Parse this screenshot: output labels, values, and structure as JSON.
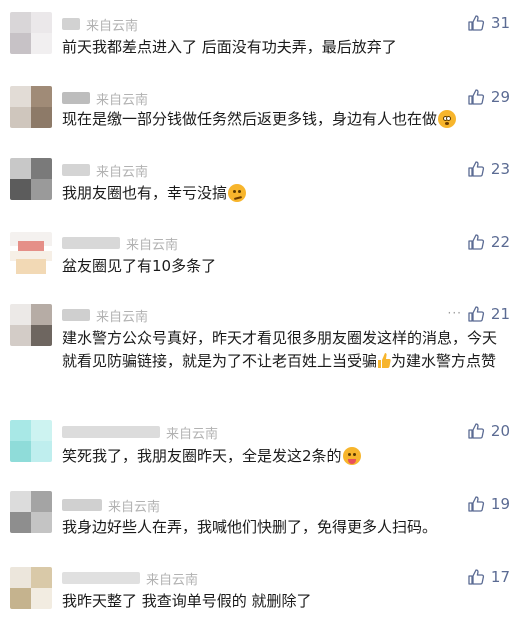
{
  "comments": [
    {
      "region": "来自云南",
      "likes": "31",
      "text": "前天我都差点进入了  后面没有功夫弄，最后放弃了",
      "emoji": ""
    },
    {
      "region": "来自云南",
      "likes": "29",
      "text": "现在是缴一部分钱做任务然后返更多钱，身边有人也在做",
      "emoji": "dizzy-face-emoji"
    },
    {
      "region": "来自云南",
      "likes": "23",
      "text": "我朋友圈也有，幸亏没搞",
      "emoji": "thinking-face-emoji"
    },
    {
      "region": "来自云南",
      "likes": "22",
      "text": "盆友圈见了有10多条了",
      "emoji": ""
    },
    {
      "region": "来自云南",
      "likes": "21",
      "text_before": "建水警方公众号真好，昨天才看见很多朋友圈发这样的消息，今天就看见防骗链接，就是为了不让老百姓上当受骗",
      "text_after": "为建水警方点赞",
      "emoji": "thumbs-up-emoji",
      "more": "···"
    },
    {
      "region": "来自云南",
      "likes": "20",
      "text": "笑死我了，我朋友圈昨天，全是发这2条的",
      "emoji": "tongue-face-emoji"
    },
    {
      "region": "来自云南",
      "likes": "19",
      "text": "我身边好些人在弄，我喊他们快删了，免得更多人扫码。",
      "emoji": ""
    },
    {
      "region": "来自云南",
      "likes": "17",
      "text": "我昨天整了  我查询单号假的 就删除了",
      "emoji": ""
    }
  ],
  "colors": {
    "region": "#b2b2b2",
    "likes": "#5b6b93",
    "text": "#1a1a1a",
    "emoji": "#f7b52c"
  }
}
